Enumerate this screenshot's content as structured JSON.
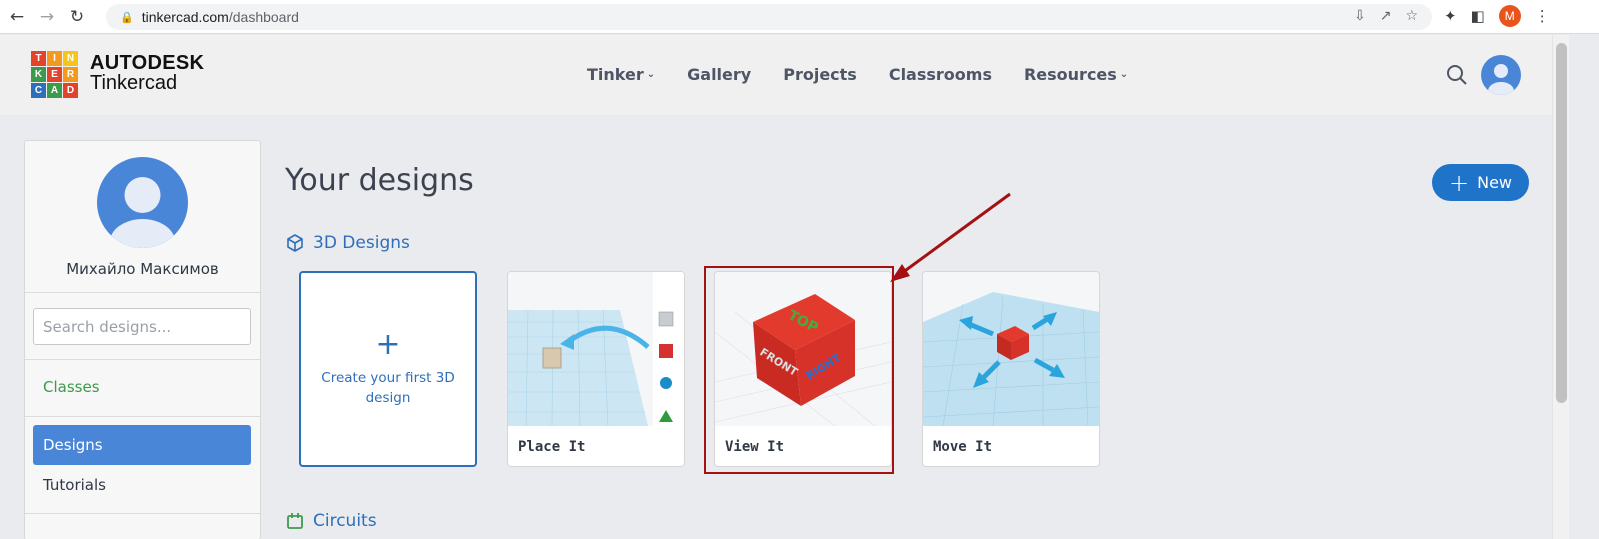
{
  "browser": {
    "url_host": "tinkercad.com",
    "url_path": "/dashboard",
    "profile_initial": "M"
  },
  "logo": {
    "letters": [
      "T",
      "I",
      "N",
      "K",
      "E",
      "R",
      "C",
      "A",
      "D"
    ],
    "line1": "AUTODESK",
    "line2": "Tinkercad"
  },
  "nav": {
    "tinker": "Tinker",
    "gallery": "Gallery",
    "projects": "Projects",
    "classrooms": "Classrooms",
    "resources": "Resources"
  },
  "sidebar": {
    "user_name": "Михайло Максимов",
    "search_placeholder": "Search designs...",
    "classes": "Classes",
    "designs": "Designs",
    "tutorials": "Tutorials"
  },
  "main": {
    "title": "Your designs",
    "new_button": "New",
    "section_3d": "3D Designs",
    "section_circuits": "Circuits",
    "create_card": "Create your first 3D design",
    "cards": [
      {
        "label": "Place It",
        "icon": "place-it-thumbnail"
      },
      {
        "label": "View It",
        "icon": "view-it-thumbnail"
      },
      {
        "label": "Move It",
        "icon": "move-it-thumbnail"
      }
    ]
  },
  "colors": {
    "accent": "#1f73c8",
    "sidebar_active": "#4a86d8",
    "highlight": "#a31111",
    "classes_green": "#3d9a4b"
  }
}
